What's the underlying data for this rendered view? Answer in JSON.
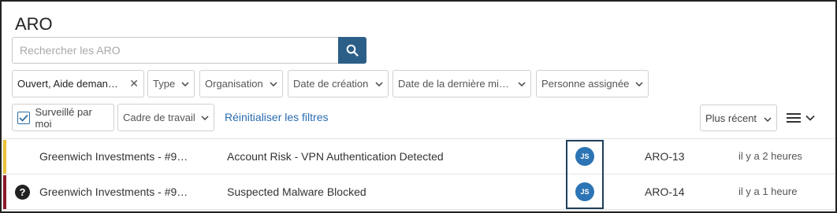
{
  "page": {
    "title": "ARO"
  },
  "search": {
    "placeholder": "Rechercher les ARO",
    "value": ""
  },
  "filters": {
    "status": "Ouvert, Aide demandée",
    "type": "Type",
    "organisation": "Organisation",
    "created": "Date de création",
    "last_modified": "Date de la dernière mis…",
    "assignee": "Personne assignée",
    "watched_label": "Surveillé par moi",
    "watched_checked": true,
    "workframe": "Cadre de travail",
    "reset": "Réinitialiser les filtres"
  },
  "sort": {
    "value": "Plus récent"
  },
  "rows": [
    {
      "customer": "Greenwich Investments - #9…",
      "title": "Account Risk - VPN Authentication Detected",
      "assignee_initials": "JS",
      "id": "ARO-13",
      "time": "il y a 2 heures",
      "priority_color": "#e8c23a",
      "help_icon": false
    },
    {
      "customer": "Greenwich Investments - #9…",
      "title": "Suspected Malware Blocked",
      "assignee_initials": "JS",
      "id": "ARO-14",
      "time": "il y a 1 heure",
      "priority_color": "#8b1a2b",
      "help_icon": true,
      "help_symbol": "?"
    }
  ]
}
